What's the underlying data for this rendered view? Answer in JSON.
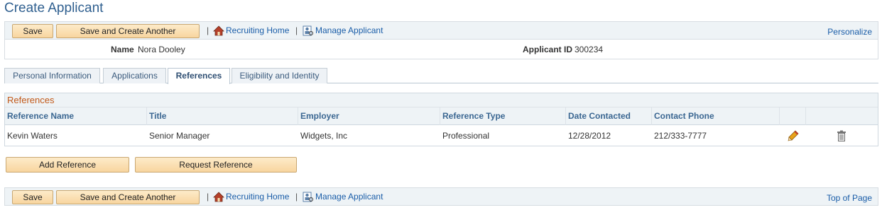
{
  "page": {
    "title": "Create Applicant"
  },
  "toolbar": {
    "save_label": "Save",
    "save_create_label": "Save and Create Another",
    "separator": "|",
    "recruiting_home_label": "Recruiting Home",
    "manage_applicant_label": "Manage Applicant",
    "personalize_label": "Personalize"
  },
  "header": {
    "name_label": "Name",
    "name_value": "Nora Dooley",
    "applicant_id_label": "Applicant ID",
    "applicant_id_value": "300234"
  },
  "tabs": [
    {
      "label": "Personal Information",
      "active": false
    },
    {
      "label": "Applications",
      "active": false
    },
    {
      "label": "References",
      "active": true
    },
    {
      "label": "Eligibility and Identity",
      "active": false
    }
  ],
  "references": {
    "title": "References",
    "columns": [
      "Reference Name",
      "Title",
      "Employer",
      "Reference Type",
      "Date Contacted",
      "Contact Phone"
    ],
    "rows": [
      {
        "name": "Kevin Waters",
        "title": "Senior Manager",
        "employer": "Widgets, Inc",
        "type": "Professional",
        "date": "12/28/2012",
        "phone": "212/333-7777",
        "edit_icon": "pencil-icon",
        "delete_icon": "trash-icon"
      }
    ]
  },
  "actions": {
    "add_reference_label": "Add Reference",
    "request_reference_label": "Request Reference"
  },
  "bottom_toolbar": {
    "save_label": "Save",
    "save_create_label": "Save and Create Another",
    "separator": "|",
    "recruiting_home_label": "Recruiting Home",
    "manage_applicant_label": "Manage Applicant",
    "top_of_page_label": "Top of Page"
  },
  "colors": {
    "link": "#1a5da8",
    "title": "#2f5f8f",
    "section_title": "#c25a1a",
    "button": "#f8d59f"
  }
}
